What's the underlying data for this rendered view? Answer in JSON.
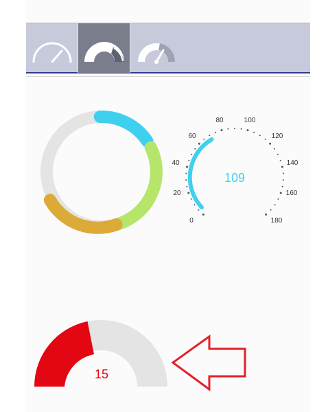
{
  "toolbar": {
    "tabs": [
      {
        "icon": "gauge-outline-icon",
        "selected": false
      },
      {
        "icon": "gauge-filled-icon",
        "selected": true
      },
      {
        "icon": "gauge-needle-icon",
        "selected": false
      }
    ]
  },
  "speedometer": {
    "value": "109",
    "value_color": "#3fd0f0",
    "tick_labels": [
      "0",
      "20",
      "40",
      "60",
      "80",
      "100",
      "120",
      "140",
      "160",
      "180"
    ]
  },
  "half_gauge": {
    "value": "15",
    "value_color": "#e8000a",
    "fill_color": "#e30613",
    "track_color": "#e4e4e4"
  },
  "ring_gauge": {
    "segment_colors": [
      "#3fd0f0",
      "#b5e66a",
      "#dcaa36"
    ],
    "track_color": "#e4e4e4"
  },
  "annotation": {
    "icon": "left-arrow-outline-icon",
    "color": "#e3202a"
  }
}
